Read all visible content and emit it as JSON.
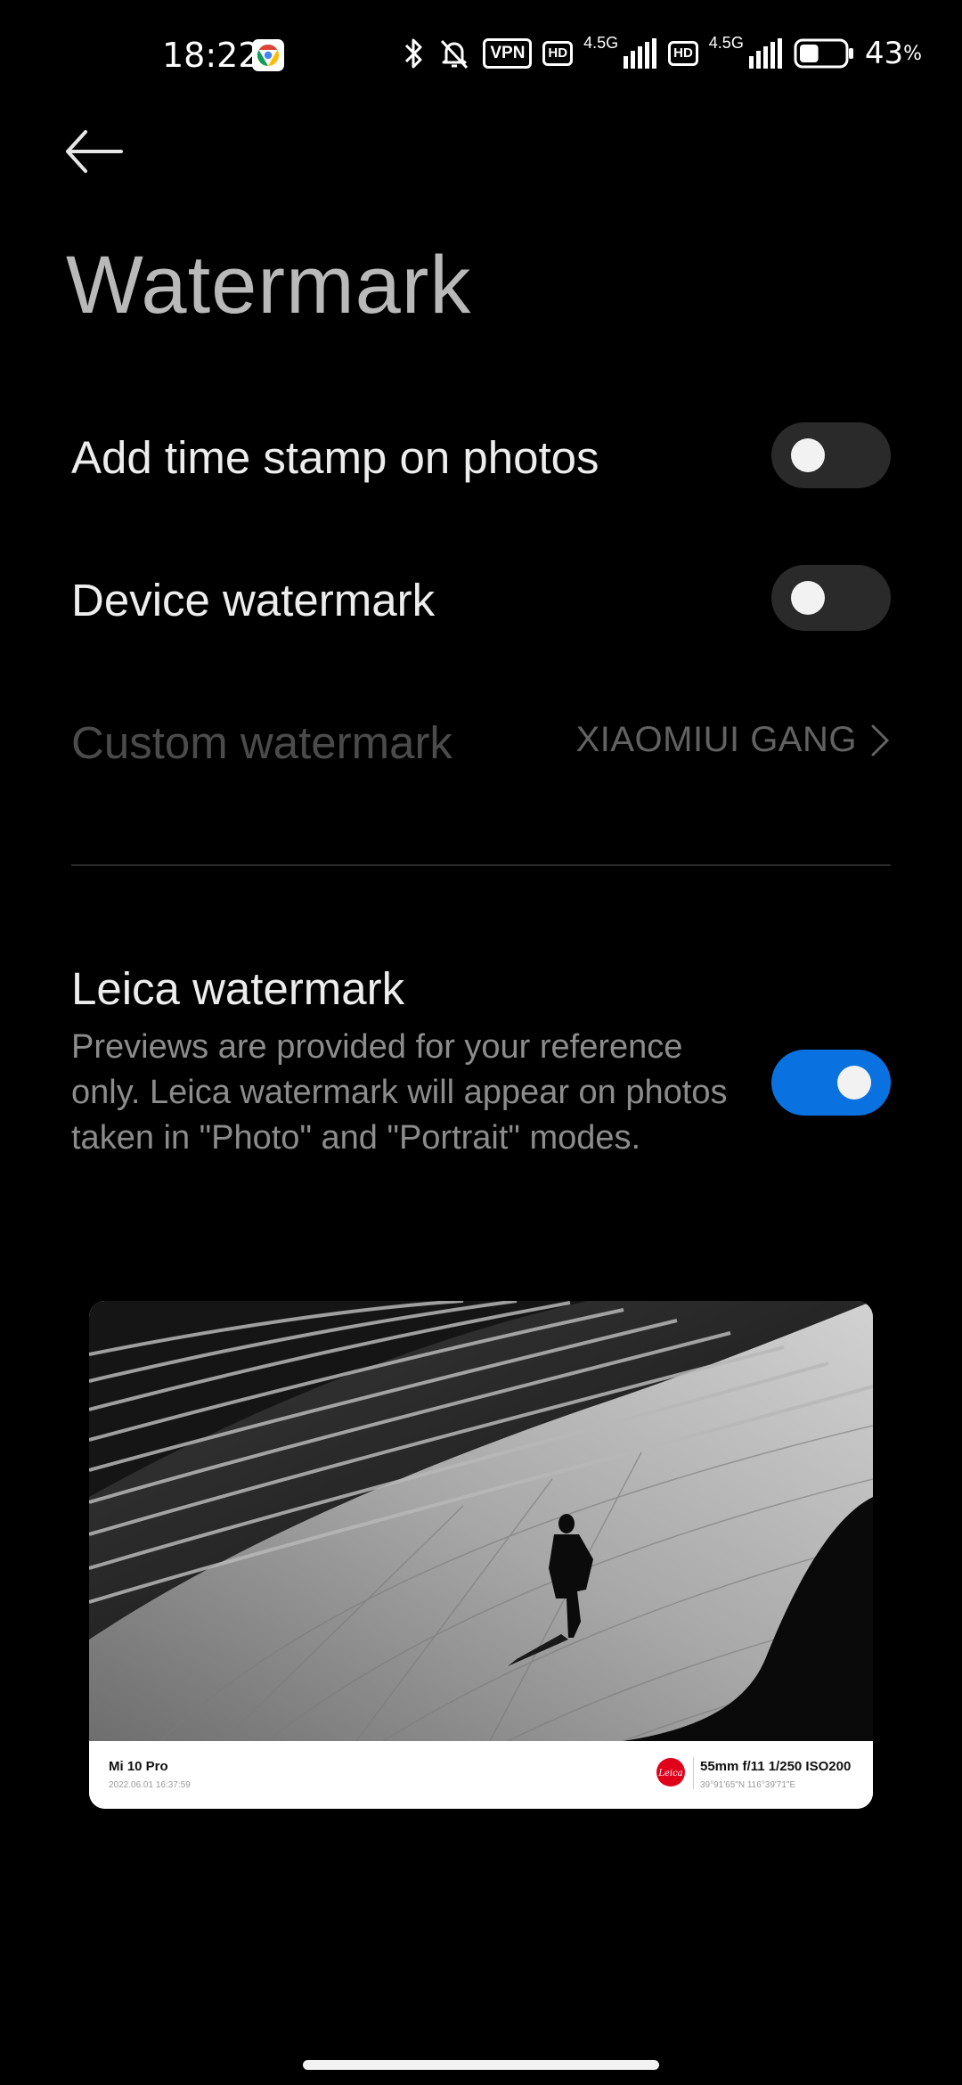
{
  "status_bar": {
    "time": "18:22",
    "vpn": "VPN",
    "hd1": "HD",
    "net1": "4.5G",
    "hd2": "HD",
    "net2": "4.5G",
    "battery_value": "43",
    "battery_unit": "%",
    "battery_level": 0.43,
    "icons": [
      "chrome-icon",
      "bluetooth-icon",
      "bell-off-icon",
      "vpn-icon",
      "hd-icon",
      "signal-icon",
      "battery-icon"
    ]
  },
  "header": {
    "title": "Watermark"
  },
  "settings": {
    "timestamp": {
      "label": "Add time stamp on photos",
      "enabled": false
    },
    "device_watermark": {
      "label": "Device watermark",
      "enabled": false
    },
    "custom_watermark": {
      "label": "Custom watermark",
      "value": "XIAOMIUI GANG",
      "disabled": true
    },
    "leica": {
      "label": "Leica watermark",
      "description": "Previews are provided for your reference only. Leica watermark will appear on photos taken in \"Photo\" and \"Portrait\" modes.",
      "enabled": true
    }
  },
  "preview": {
    "device": "Mi 10 Pro",
    "datetime": "2022.06.01 16:37:59",
    "logo_text": "Leica",
    "params": "55mm  f/11  1/250  ISO200",
    "coords": "39°91'65\"N  116°39'71\"E"
  },
  "colors": {
    "background": "#000000",
    "accent": "#0a72e0",
    "toggle_off": "#2a2a2a",
    "leica_red": "#e0001a"
  }
}
